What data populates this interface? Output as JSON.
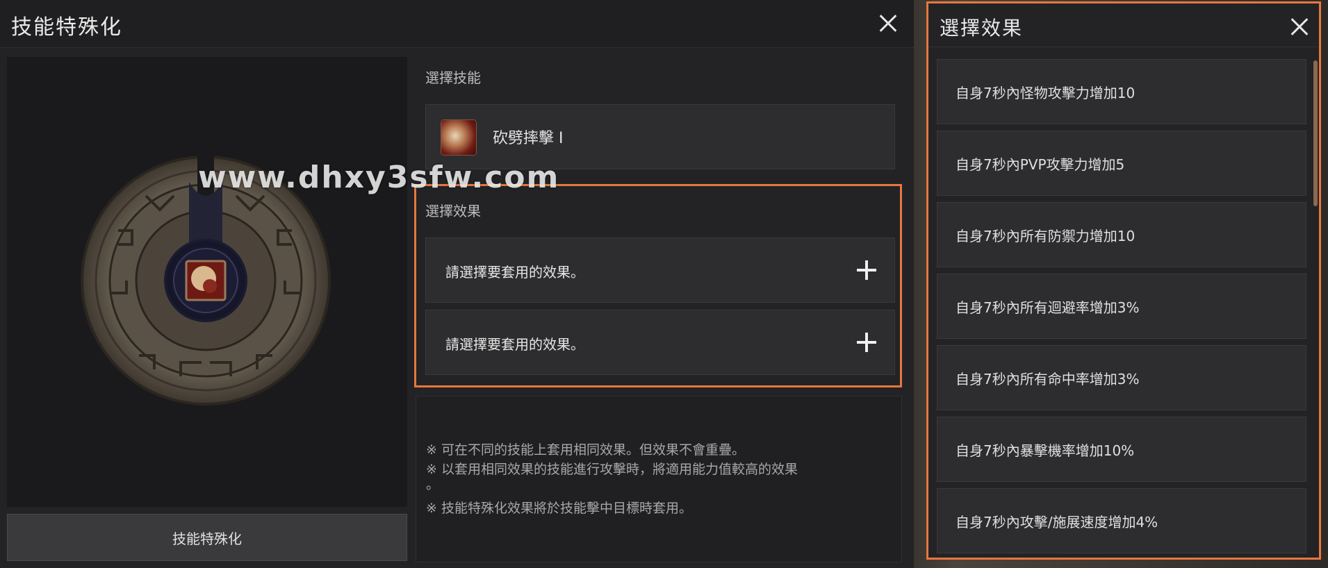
{
  "main": {
    "title": "技能特殊化",
    "specialize_button": "技能特殊化",
    "select_skill_label": "選擇技能",
    "skill_name": "砍劈摔擊 I",
    "select_effect_label": "選擇效果",
    "effect_slots": [
      {
        "label": "請選擇要套用的效果。"
      },
      {
        "label": "請選擇要套用的效果。"
      }
    ],
    "notes": [
      "※ 可在不同的技能上套用相同效果。但效果不會重疊。",
      "※ 以套用相同效果的技能進行攻擊時，將適用能力值較高的效果",
      "。",
      "※ 技能特殊化效果將於技能擊中目標時套用。"
    ]
  },
  "watermark": "www.dhxy3sfw.com",
  "effect_panel": {
    "title": "選擇效果",
    "options": [
      {
        "label": "自身7秒內怪物攻擊力增加10"
      },
      {
        "label": "自身7秒內PVP攻擊力增加5"
      },
      {
        "label": "自身7秒內所有防禦力增加10"
      },
      {
        "label": "自身7秒內所有迴避率增加3%"
      },
      {
        "label": "自身7秒內所有命中率增加3%"
      },
      {
        "label": "自身7秒內暴擊機率增加10%"
      },
      {
        "label": "自身7秒內攻擊/施展速度增加4%"
      }
    ]
  },
  "colors": {
    "highlight": "#e8773f",
    "panel": "#232325",
    "row": "#2d2d2f"
  }
}
